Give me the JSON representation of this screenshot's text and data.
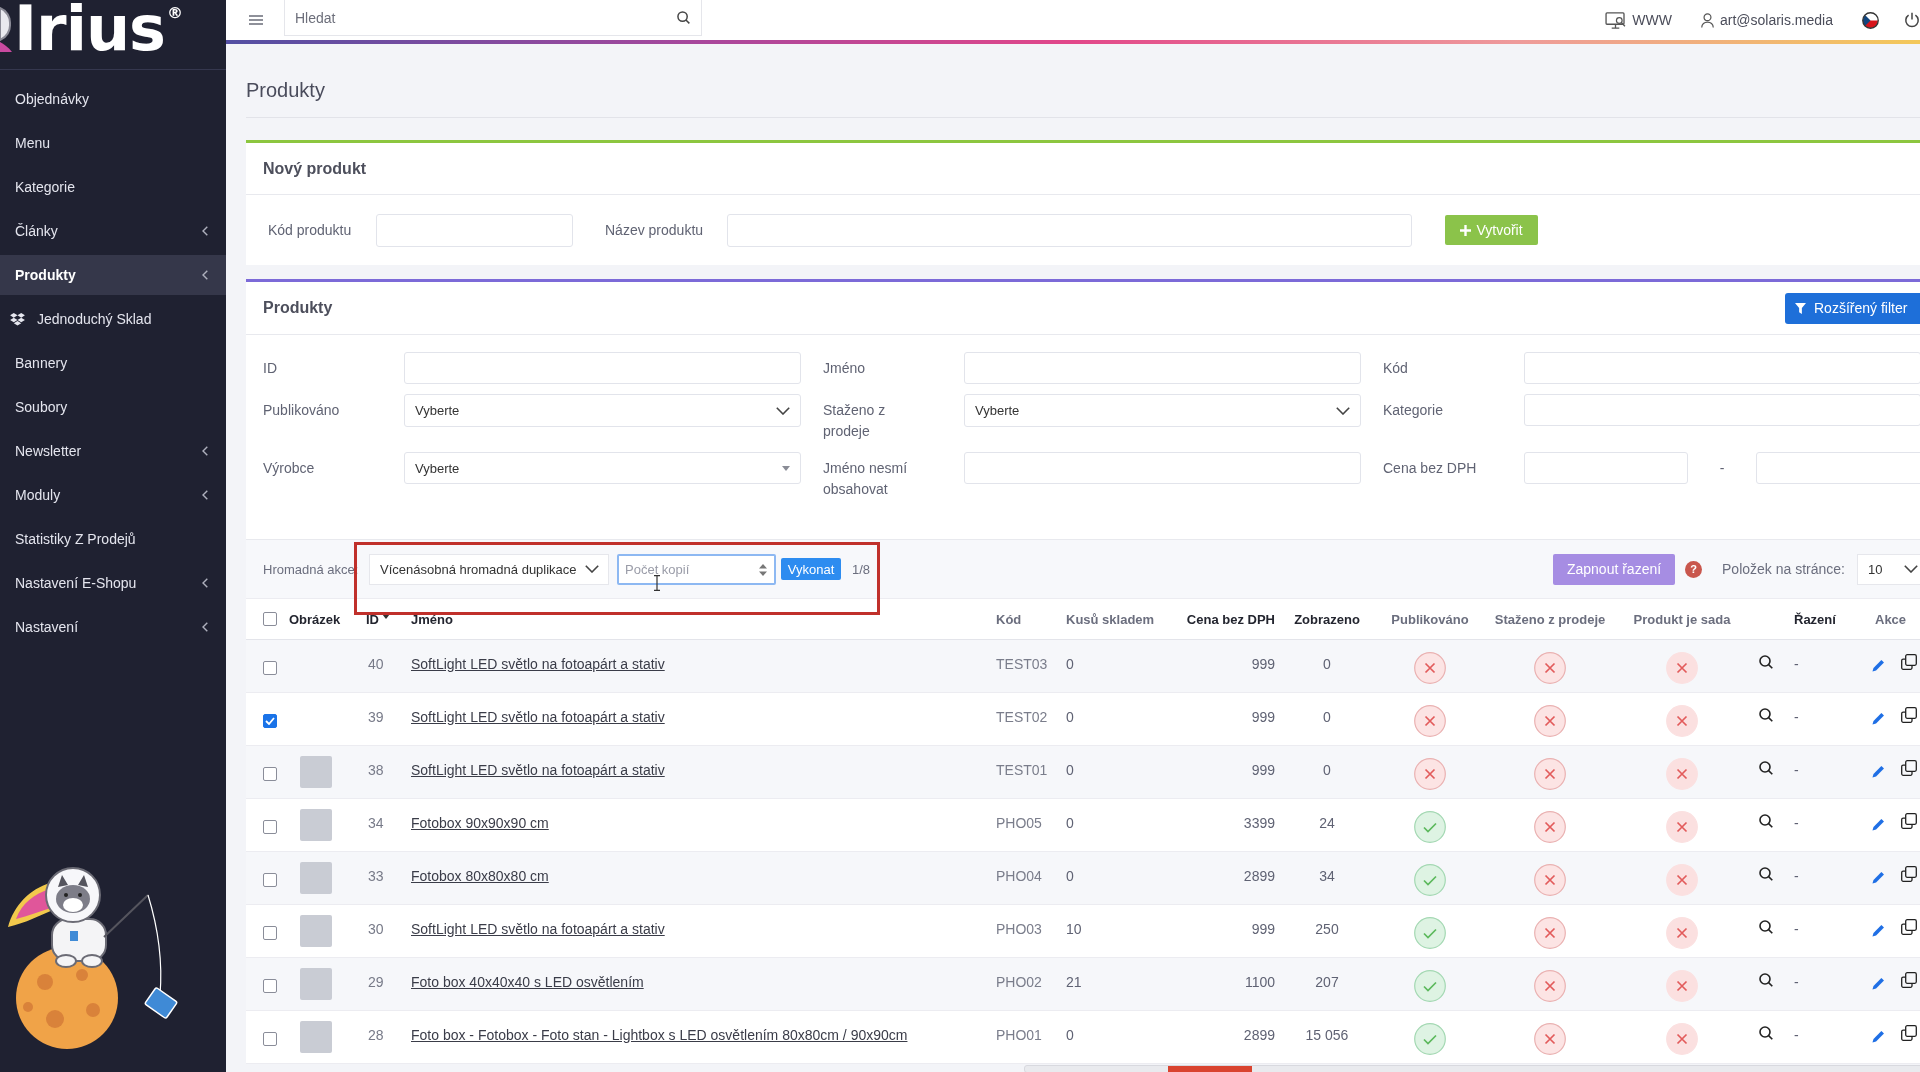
{
  "sidebar": {
    "logo": {
      "name": "Irius",
      "mark": "®"
    },
    "items": [
      {
        "label": "Objednávky",
        "kind": "text",
        "selected": false,
        "expandable": false
      },
      {
        "label": "Menu",
        "kind": "text",
        "selected": false,
        "expandable": false
      },
      {
        "label": "Kategorie",
        "kind": "text",
        "selected": false,
        "expandable": false
      },
      {
        "label": "Články",
        "kind": "text",
        "selected": false,
        "expandable": true
      },
      {
        "label": "Produkty",
        "kind": "text",
        "selected": true,
        "expandable": true
      },
      {
        "label": "Jednoduchý Sklad",
        "kind": "icon",
        "selected": false,
        "expandable": false
      },
      {
        "label": "Bannery",
        "kind": "text",
        "selected": false,
        "expandable": false
      },
      {
        "label": "Soubory",
        "kind": "text",
        "selected": false,
        "expandable": false
      },
      {
        "label": "Newsletter",
        "kind": "text",
        "selected": false,
        "expandable": true
      },
      {
        "label": "Moduly",
        "kind": "text",
        "selected": false,
        "expandable": true
      },
      {
        "label": "Statistiky Z Prodejů",
        "kind": "text",
        "selected": false,
        "expandable": false
      },
      {
        "label": "Nastavení E-Shopu",
        "kind": "text",
        "selected": false,
        "expandable": true
      },
      {
        "label": "Nastavení",
        "kind": "text",
        "selected": false,
        "expandable": true
      }
    ]
  },
  "topbar": {
    "search": {
      "placeholder": "Hledat"
    },
    "site_link": "WWW",
    "user": "art@solaris.media"
  },
  "page_title": "Produkty",
  "new_product": {
    "title": "Nový produkt",
    "fields": [
      {
        "label": "Kód produktu"
      },
      {
        "label": "Název produktu"
      }
    ],
    "create_button": "Vytvořit"
  },
  "products": {
    "title": "Produkty",
    "filter_button": "Rozšířený filter",
    "filters": [
      {
        "label": "ID",
        "kind": "text"
      },
      {
        "label": "Jméno",
        "kind": "text"
      },
      {
        "label": "Kód",
        "kind": "text"
      },
      {
        "label": "Publikováno",
        "kind": "select",
        "value": "Vyberte"
      },
      {
        "label": "Staženo z prodeje",
        "kind": "select",
        "value": "Vyberte"
      },
      {
        "label": "Kategorie",
        "kind": "text"
      },
      {
        "label": "Výrobce",
        "kind": "dropdown",
        "value": "Vyberte"
      },
      {
        "label": "Jméno nesmí obsahovat",
        "kind": "text"
      },
      {
        "label": "Cena bez DPH",
        "kind": "range",
        "separator": "-"
      }
    ],
    "bulk_action": {
      "label": "Hromadná akce:",
      "action": "Vícenásobná hromadná duplikace",
      "copies": {
        "placeholder": "Počet kopií",
        "focused": true
      },
      "run_button": "Vykonat",
      "selection": "1/8"
    },
    "sort_button": "Zapnout řazení",
    "help_button": "?",
    "per_page": {
      "label": "Položek na stránce:",
      "value": "10"
    },
    "table": {
      "select_all_checked": false,
      "columns": [
        {
          "label": "Obrázek",
          "strong": true,
          "sorted": false
        },
        {
          "label": "ID",
          "strong": true,
          "sorted": true
        },
        {
          "label": "Jméno",
          "strong": true,
          "sorted": false
        },
        {
          "label": "Kód",
          "strong": false,
          "sorted": false
        },
        {
          "label": "Kusů skladem",
          "strong": false,
          "sorted": false
        },
        {
          "label": "Cena bez DPH",
          "strong": true,
          "sorted": false
        },
        {
          "label": "Zobrazeno",
          "strong": true,
          "sorted": false
        },
        {
          "label": "Publikováno",
          "strong": false,
          "sorted": false
        },
        {
          "label": "Staženo z prodeje",
          "strong": false,
          "sorted": false
        },
        {
          "label": "Produkt je sada",
          "strong": false,
          "sorted": false
        },
        {
          "label": "Řazení",
          "strong": true,
          "sorted": false
        },
        {
          "label": "Akce",
          "strong": false,
          "sorted": false
        }
      ],
      "rows": [
        {
          "selected": false,
          "image": false,
          "id": "40",
          "name": "SoftLight LED světlo na fotoapárt a stativ",
          "code": "TEST03",
          "stock": "0",
          "price": "999",
          "views": "0",
          "published": false,
          "withdrawn": false,
          "is_set": false,
          "order": "-"
        },
        {
          "selected": true,
          "image": false,
          "id": "39",
          "name": "SoftLight LED světlo na fotoapárt a stativ",
          "code": "TEST02",
          "stock": "0",
          "price": "999",
          "views": "0",
          "published": false,
          "withdrawn": false,
          "is_set": false,
          "order": "-"
        },
        {
          "selected": false,
          "image": true,
          "id": "38",
          "name": "SoftLight LED světlo na fotoapárt a stativ",
          "code": "TEST01",
          "stock": "0",
          "price": "999",
          "views": "0",
          "published": false,
          "withdrawn": false,
          "is_set": false,
          "order": "-"
        },
        {
          "selected": false,
          "image": true,
          "id": "34",
          "name": "Fotobox 90x90x90 cm",
          "code": "PHO05",
          "stock": "0",
          "price": "3399",
          "views": "24",
          "published": true,
          "withdrawn": false,
          "is_set": false,
          "order": "-"
        },
        {
          "selected": false,
          "image": true,
          "id": "33",
          "name": "Fotobox 80x80x80 cm",
          "code": "PHO04",
          "stock": "0",
          "price": "2899",
          "views": "34",
          "published": true,
          "withdrawn": false,
          "is_set": false,
          "order": "-"
        },
        {
          "selected": false,
          "image": true,
          "id": "30",
          "name": "SoftLight LED světlo na fotoapárt a stativ",
          "code": "PHO03",
          "stock": "10",
          "price": "999",
          "views": "250",
          "published": true,
          "withdrawn": false,
          "is_set": false,
          "order": "-"
        },
        {
          "selected": false,
          "image": true,
          "id": "29",
          "name": "Foto box 40x40x40 s LED osvětlením",
          "code": "PHO02",
          "stock": "21",
          "price": "1100",
          "views": "207",
          "published": true,
          "withdrawn": false,
          "is_set": false,
          "order": "-"
        },
        {
          "selected": false,
          "image": true,
          "id": "28",
          "name": "Foto box - Fotobox - Foto stan - Lightbox s LED osvětlením 80x80cm / 90x90cm",
          "code": "PHO01",
          "stock": "0",
          "price": "2899",
          "views": "15 056",
          "published": true,
          "withdrawn": false,
          "is_set": false,
          "order": "-"
        }
      ]
    }
  }
}
